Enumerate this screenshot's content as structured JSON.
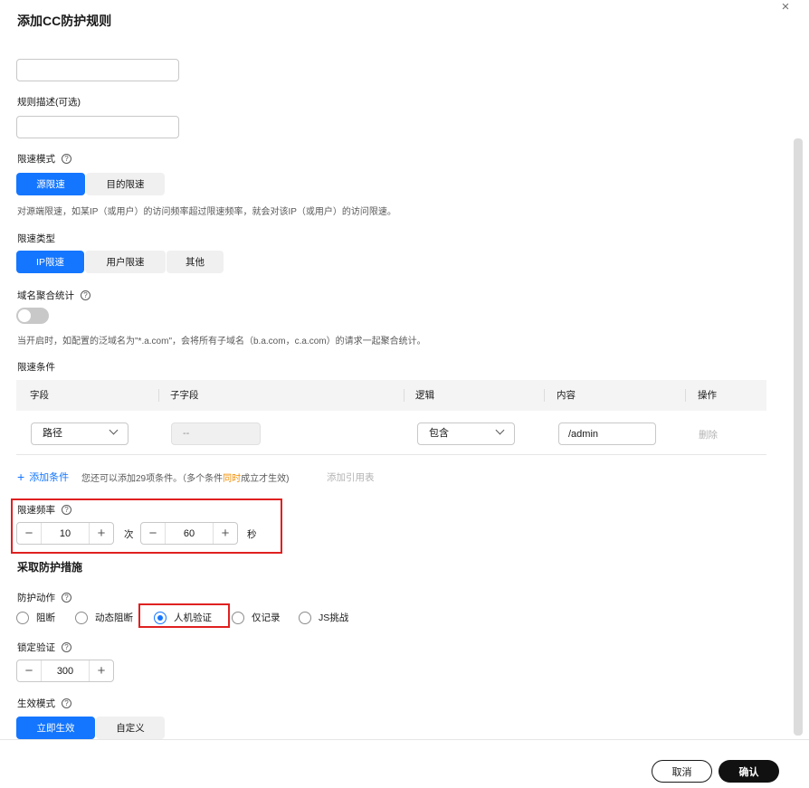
{
  "dialog": {
    "title": "添加CC防护规则",
    "close_icon": "×"
  },
  "rule_name": {
    "value": ""
  },
  "rule_desc": {
    "label": "规则描述(可选)",
    "value": ""
  },
  "limit_mode": {
    "label": "限速模式",
    "options": [
      "源限速",
      "目的限速"
    ],
    "selected": "源限速",
    "description": "对源端限速，如某IP（或用户）的访问频率超过限速频率，就会对该IP（或用户）的访问限速。"
  },
  "limit_type": {
    "label": "限速类型",
    "options": [
      "IP限速",
      "用户限速",
      "其他"
    ],
    "selected": "IP限速"
  },
  "domain_aggregation": {
    "label": "域名聚合统计",
    "enabled": false,
    "description": "当开启时，如配置的泛域名为\"*.a.com\"，会将所有子域名（b.a.com，c.a.com）的请求一起聚合统计。"
  },
  "conditions": {
    "label": "限速条件",
    "columns": [
      "字段",
      "子字段",
      "逻辑",
      "内容",
      "操作"
    ],
    "rows": [
      {
        "field": "路径",
        "subfield": "--",
        "logic": "包含",
        "content": "/admin",
        "action": "删除"
      }
    ],
    "add_label": "添加条件",
    "hint_prefix": "您还可以添加29项条件。（多个条件",
    "hint_highlight": "同时",
    "hint_suffix": "成立才生效)",
    "add_ref_label": "添加引用表"
  },
  "rate": {
    "label": "限速频率",
    "count": "10",
    "count_unit": "次",
    "period": "60",
    "period_unit": "秒"
  },
  "protection": {
    "section_title": "采取防护措施",
    "action_label": "防护动作",
    "actions": [
      "阻断",
      "动态阻断",
      "人机验证",
      "仅记录",
      "JS挑战"
    ],
    "selected": "人机验证"
  },
  "lock": {
    "label": "锁定验证",
    "value": "300"
  },
  "effect_mode": {
    "label": "生效模式",
    "options": [
      "立即生效",
      "自定义"
    ],
    "selected": "立即生效"
  },
  "footer": {
    "cancel_label": "取消",
    "ok_label": "确认"
  },
  "colors": {
    "accent": "#1476ff",
    "highlight_box": "#e02020",
    "warning_text": "#f08c00"
  }
}
